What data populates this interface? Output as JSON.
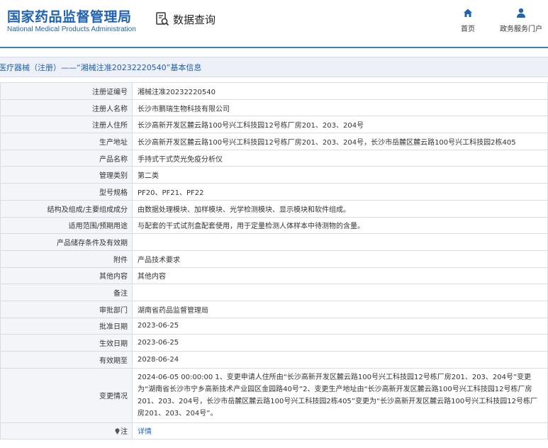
{
  "header": {
    "logo_cn": "国家药品监督管理局",
    "logo_en": "National Medical Products Administration",
    "query_label": "数据查询",
    "nav_home": "首页",
    "nav_portal": "政务服务门户"
  },
  "title": "医疗器械（注册）——“湘械注准20232220540”基本信息",
  "rows": [
    {
      "label": "注册证编号",
      "value": "湘械注准20232220540"
    },
    {
      "label": "注册人名称",
      "value": "长沙市鹏瑞生物科技有限公司"
    },
    {
      "label": "注册人住所",
      "value": "长沙高新开发区麓云路100号兴工科技园12号栋厂房201、203、204号"
    },
    {
      "label": "生产地址",
      "value": "长沙高新开发区麓云路100号兴工科技园12号栋厂房201、203、204号，长沙市岳麓区麓云路100号兴工科技园2栋405"
    },
    {
      "label": "产品名称",
      "value": "手持式干式荧光免疫分析仪"
    },
    {
      "label": "管理类别",
      "value": "第二类"
    },
    {
      "label": "型号规格",
      "value": "PF20、PF21、PF22"
    },
    {
      "label": "结构及组成/主要组成成分",
      "value": "由数据处理模块、加样模块、光学检测模块、显示模块和软件组成。"
    },
    {
      "label": "适用范围/预期用途",
      "value": "与配套的干式试剂盒配套使用，用于定量检测人体样本中待测物的含量。"
    },
    {
      "label": "产品储存条件及有效期",
      "value": ""
    },
    {
      "label": "附件",
      "value": "产品技术要求"
    },
    {
      "label": "其他内容",
      "value": "其他内容"
    },
    {
      "label": "备注",
      "value": ""
    },
    {
      "label": "审批部门",
      "value": "湖南省药品监督管理局"
    },
    {
      "label": "批准日期",
      "value": "2023-06-25"
    },
    {
      "label": "生效日期",
      "value": "2023-06-25"
    },
    {
      "label": "有效期至",
      "value": "2028-06-24"
    }
  ],
  "change": {
    "label": "变更情况",
    "value": "2024-06-05 00:00:00 1、变更申请人住所由“长沙高新开发区麓云路100号兴工科技园12号栋厂房201、203、204号”变更为“湖南省长沙市宁乡高新技术产业园区金园路40号”2、变更生产地址由“长沙高新开发区麓云路100号兴工科技园12号栋厂房201、203、204号，长沙市岳麓区麓云路100号兴工科技园2栋405”变更为“长沙高新开发区麓云路100号兴工科技园12号栋厂房201、203、204号”。"
  },
  "note": {
    "label": "注",
    "link": "详情"
  },
  "colors": {
    "brand": "#1f63b2",
    "label_bg": "#f3f5f8",
    "title_bg": "#edf1f7"
  }
}
